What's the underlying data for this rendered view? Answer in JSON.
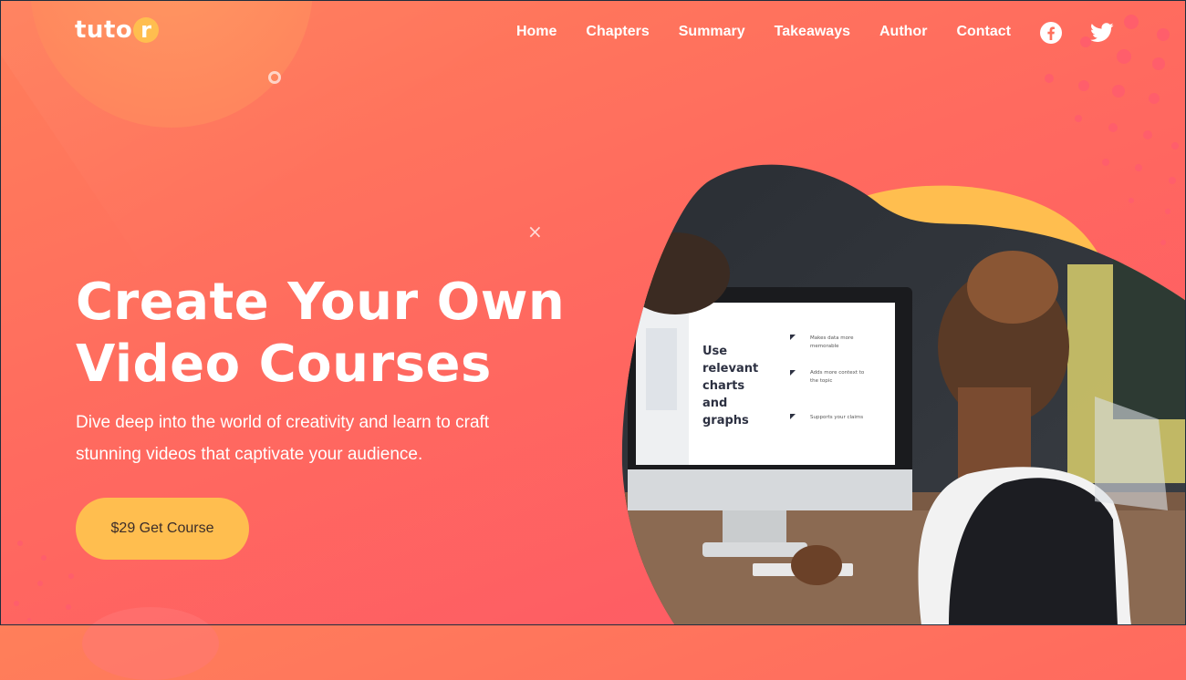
{
  "brand": {
    "prefix": "tuto",
    "suffix": "r"
  },
  "nav": {
    "items": [
      "Home",
      "Chapters",
      "Summary",
      "Takeaways",
      "Author",
      "Contact"
    ]
  },
  "social": {
    "facebook_icon": "facebook-icon",
    "twitter_icon": "twitter-icon"
  },
  "hero": {
    "title_line1": "Create Your Own",
    "title_line2": "Video Courses",
    "subtitle": "Dive deep into the world of creativity and learn to craft stunning videos that captivate your audience.",
    "cta_label": "$29 Get Course"
  },
  "monitor": {
    "heading_lines": [
      "Use",
      "relevant",
      "charts",
      "and",
      "graphs"
    ],
    "bullets": [
      "Makes data more memorable",
      "Adds more context to the topic",
      "Supports your claims"
    ]
  },
  "colors": {
    "accent": "#ffbe4f",
    "gradient_start": "#ff7f5a",
    "gradient_end": "#fe5766",
    "dots": "#ff5e6b"
  }
}
